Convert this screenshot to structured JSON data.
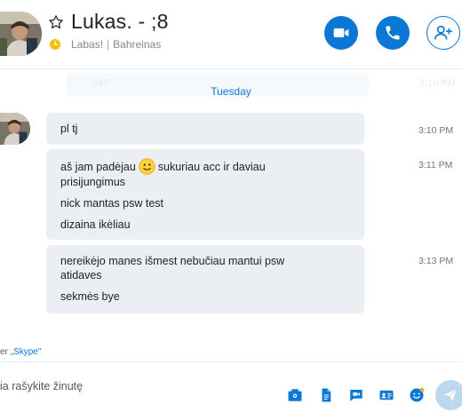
{
  "header": {
    "contact_name": "Lukas. - ;8",
    "mood_message": "Labas!",
    "location": "Bahreinas",
    "separator": "|",
    "icons": [
      "avatar",
      "star-icon",
      "clock-status-icon",
      "video-call-icon",
      "audio-call-icon",
      "add-contact-icon"
    ]
  },
  "ghost": {
    "left_text": "5s?",
    "right_text": "3:10 PM"
  },
  "date_divider": "Tuesday",
  "messages": [
    {
      "lines": [
        "pl tj"
      ],
      "time": "3:10 PM"
    },
    {
      "lines": [
        "aš jam padėjau",
        "sukuriau acc ir daviau",
        "prisijungimus",
        "nick mantas psw test",
        "dizaina ikėliau"
      ],
      "time": "3:11 PM",
      "emoji": "smile-emoji"
    },
    {
      "lines": [
        "nereikėjo manes išmest nebučiau mantui psw",
        "atidaves",
        "sekmės bye"
      ],
      "time": "3:13 PM"
    }
  ],
  "via": {
    "prefix": "er",
    "link": "„Skype\""
  },
  "composer": {
    "placeholder": "ia rašykite žinutę",
    "tools": [
      "media-gallery-icon",
      "file-icon",
      "video-message-icon",
      "contact-card-icon",
      "emoticon-icon",
      "send-icon"
    ]
  },
  "colors": {
    "accent": "#0a78d4",
    "bubble": "#ebeff3",
    "send_disabled": "#bcd8ef",
    "status_away": "#f5c000"
  }
}
